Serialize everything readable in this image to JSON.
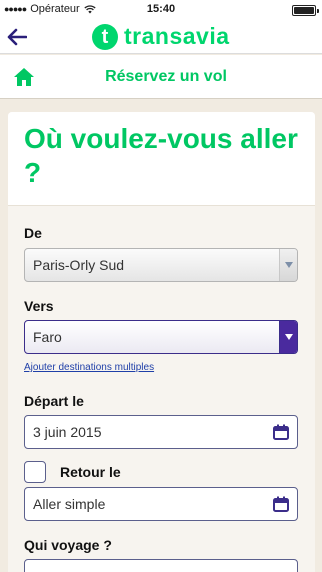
{
  "status_bar": {
    "carrier": "Opérateur",
    "time": "15:40"
  },
  "header": {
    "logo_mark": "t",
    "logo_text": "transavia",
    "brand_color": "#00d66e"
  },
  "subheader": {
    "title": "Réservez un vol"
  },
  "card": {
    "title": "Où voulez-vous aller ?",
    "from_label": "De",
    "from_value": "Paris-Orly Sud",
    "to_label": "Vers",
    "to_value": "Faro",
    "multi_dest_link": "Ajouter destinations multiples",
    "departure_label": "Départ le",
    "departure_value": "3 juin 2015",
    "return_label": "Retour le",
    "return_value": "Aller simple",
    "travelers_label": "Qui voyage ?"
  },
  "colors": {
    "accent_purple": "#4a2a9e",
    "link_blue": "#1f3fa8"
  }
}
